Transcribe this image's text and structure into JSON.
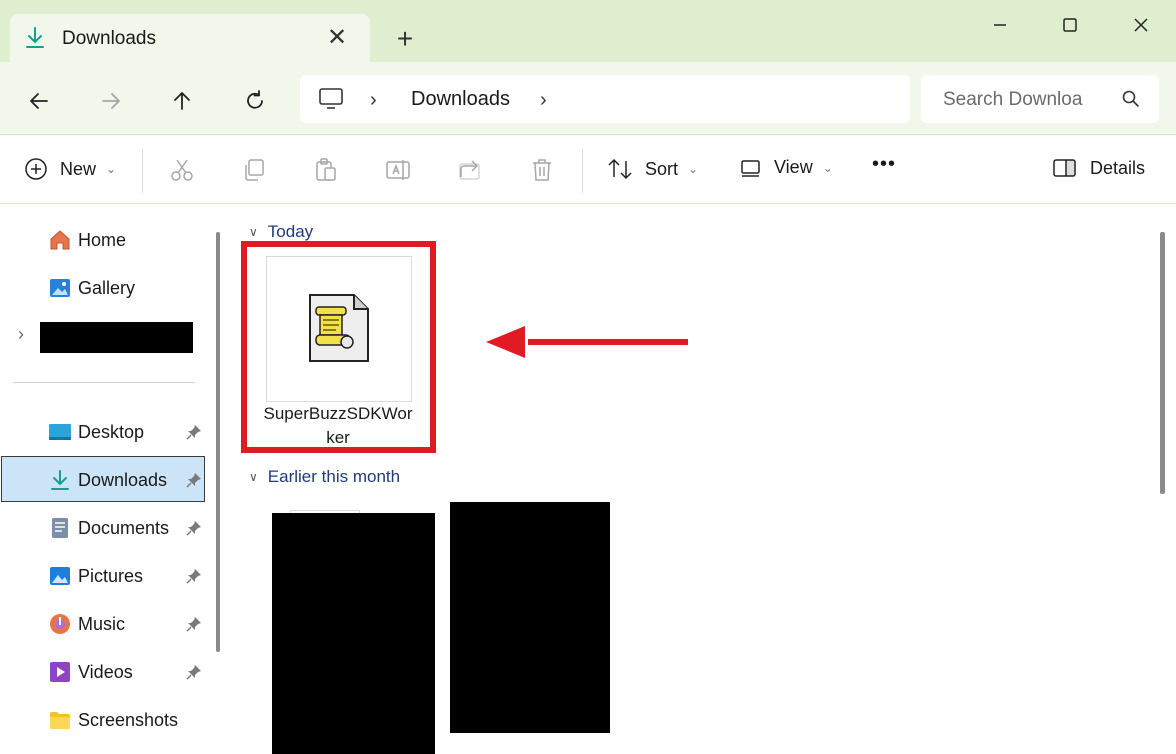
{
  "window": {
    "tab_title": "Downloads",
    "tab_icon": "download-arrow-icon",
    "new_tab_label": "+",
    "close_tab_label": "✕",
    "controls": [
      "minimize-icon",
      "maximize-icon",
      "close-icon"
    ]
  },
  "navigation": {
    "buttons": [
      "back-icon",
      "forward-icon",
      "up-icon",
      "refresh-icon"
    ],
    "breadcrumb": [
      "Downloads"
    ],
    "search_placeholder": "Search Downloa"
  },
  "toolbar": {
    "new_label": "New",
    "sort_label": "Sort",
    "view_label": "View",
    "more_label": "•••",
    "details_label": "Details",
    "icons": [
      "cut-icon",
      "copy-icon",
      "paste-icon",
      "rename-icon",
      "share-icon",
      "delete-icon"
    ]
  },
  "sidebar": {
    "top_items": [
      {
        "label": "Home",
        "icon": "home-icon"
      },
      {
        "label": "Gallery",
        "icon": "gallery-icon"
      }
    ],
    "pinned_items": [
      {
        "label": "Desktop",
        "icon": "desktop-icon",
        "pinned": true
      },
      {
        "label": "Downloads",
        "icon": "download-arrow-icon",
        "pinned": true,
        "selected": true
      },
      {
        "label": "Documents",
        "icon": "documents-icon",
        "pinned": true
      },
      {
        "label": "Pictures",
        "icon": "pictures-icon",
        "pinned": true
      },
      {
        "label": "Music",
        "icon": "music-icon",
        "pinned": true
      },
      {
        "label": "Videos",
        "icon": "videos-icon",
        "pinned": true
      },
      {
        "label": "Screenshots",
        "icon": "folder-icon",
        "pinned": false
      }
    ]
  },
  "content": {
    "groups": [
      {
        "label": "Today",
        "files": [
          {
            "name": "SuperBuzzSDKWorker",
            "icon": "script-file-icon",
            "highlighted": true
          }
        ]
      },
      {
        "label": "Earlier this month",
        "files": []
      }
    ],
    "highlight_color": "#e01b24"
  },
  "colors": {
    "titlebar": "#dfeecf",
    "navbar": "#f1f7ea",
    "selection": "#cce4f7",
    "group_header": "#1f3b7a",
    "annotation_red": "#e01b24"
  }
}
